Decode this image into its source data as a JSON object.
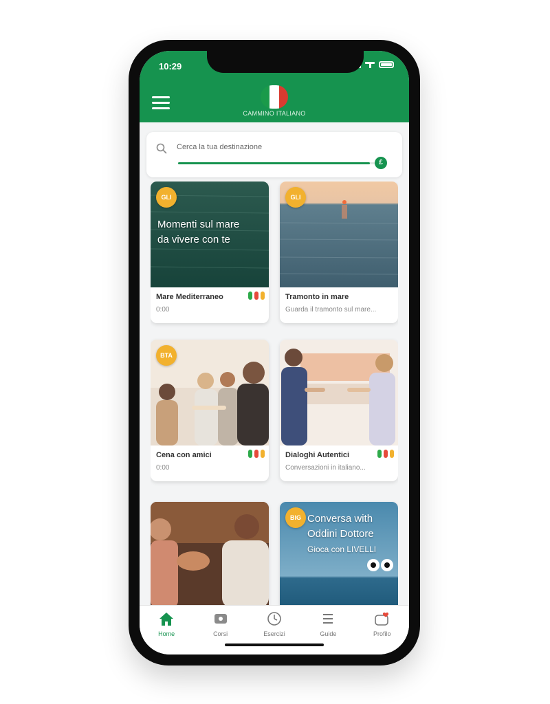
{
  "status_bar": {
    "time": "10:29"
  },
  "header": {
    "app_title": "CAMMINO ITALIANO",
    "flag_colors": [
      "#1a9a4a",
      "#ffffff",
      "#d93b30"
    ],
    "menu_icon": "hamburger-menu-icon"
  },
  "search": {
    "placeholder": "Cerca la tua destinazione",
    "progress_fraction": 0.97,
    "knob_label": "£"
  },
  "cards": [
    {
      "badge": "GLI",
      "overlay": [
        "Momenti sul mare",
        "da vivere con te"
      ],
      "title": "Mare Mediterraneo",
      "subtitle": "0:00",
      "indicators": [
        "#2eaa4a",
        "#e64a3b",
        "#f2b12e"
      ]
    },
    {
      "badge": "GLI",
      "overlay": [],
      "title": "Tramonto in mare",
      "subtitle": "Guarda il tramonto sul mare...",
      "indicators": []
    },
    {
      "badge": "BTA",
      "overlay": [],
      "title": "Cena con amici",
      "subtitle": "0:00",
      "indicators": [
        "#2eaa4a",
        "#e64a3b",
        "#f2b12e"
      ]
    },
    {
      "badge": "",
      "overlay": [],
      "title": "Dialoghi Autentici",
      "subtitle": "Conversazioni in italiano...",
      "indicators": [
        "#2eaa4a",
        "#e64a3b",
        "#f2b12e"
      ]
    },
    {
      "badge": "",
      "overlay": [],
      "title": "",
      "subtitle": "",
      "indicators": []
    },
    {
      "badge": "BIG",
      "overlay": [
        "Conversa with",
        "Oddini Dottore",
        "Gioca con LIVELLI"
      ],
      "title": "",
      "subtitle": "",
      "indicators": []
    }
  ],
  "nav": {
    "items": [
      {
        "label": "Home",
        "icon": "home-icon",
        "active": true
      },
      {
        "label": "Corsi",
        "icon": "video-icon",
        "active": false
      },
      {
        "label": "Esercizi",
        "icon": "clock-icon",
        "active": false
      },
      {
        "label": "Guide",
        "icon": "list-icon",
        "active": false
      },
      {
        "label": "Profilo",
        "icon": "heart-icon",
        "active": false
      }
    ]
  },
  "colors": {
    "primary": "#16934f",
    "accent": "#f2b12e"
  }
}
